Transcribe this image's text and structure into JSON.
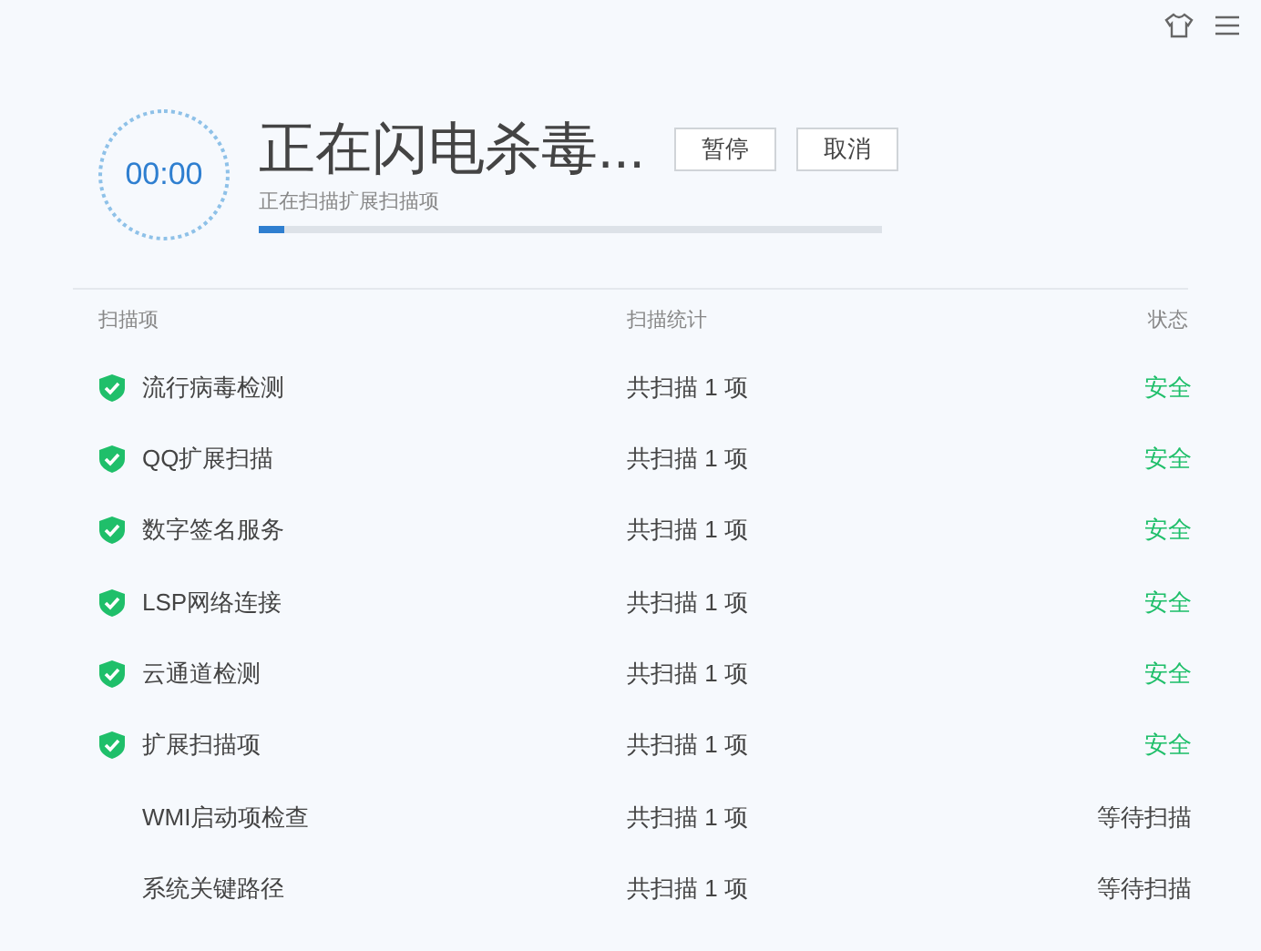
{
  "timer": "00:00",
  "title": "正在闪电杀毒...",
  "buttons": [
    "暂停",
    "取消"
  ],
  "subtitle": "正在扫描扩展扫描项",
  "progress": {
    "level": 0.04
  },
  "columns": [
    "扫描项",
    "扫描统计",
    "状态"
  ],
  "rows": [
    {
      "name": "流行病毒检测",
      "count": "共扫描 1 项",
      "status": "安全",
      "kind": "safe"
    },
    {
      "name": "QQ扩展扫描",
      "count": "共扫描 1 项",
      "status": "安全",
      "kind": "safe"
    },
    {
      "name": "数字签名服务",
      "count": "共扫描 1 项",
      "status": "安全",
      "kind": "safe"
    },
    {
      "name": "LSP网络连接",
      "count": "共扫描 1 项",
      "status": "安全",
      "kind": "safe"
    },
    {
      "name": "云通道检测",
      "count": "共扫描 1 项",
      "status": "安全",
      "kind": "safe"
    },
    {
      "name": "扩展扫描项",
      "count": "共扫描 1 项",
      "status": "安全",
      "kind": "safe"
    },
    {
      "name": "WMI启动项检查",
      "count": "共扫描 1 项",
      "status": "等待扫描",
      "kind": "waiting"
    },
    {
      "name": "系统关键路径",
      "count": "共扫描 1 项",
      "status": "等待扫描",
      "kind": "waiting"
    }
  ]
}
